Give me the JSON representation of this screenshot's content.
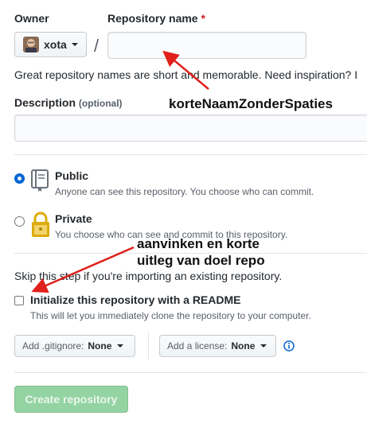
{
  "owner": {
    "label": "Owner",
    "name": "xota"
  },
  "repo": {
    "label": "Repository name",
    "required_mark": "*",
    "value": ""
  },
  "hint_text": "Great repository names are short and memorable. Need inspiration? I",
  "description": {
    "label": "Description",
    "optional": "(optional)",
    "value": ""
  },
  "visibility": {
    "public": {
      "title": "Public",
      "desc": "Anyone can see this repository. You choose who can commit.",
      "selected": true
    },
    "private": {
      "title": "Private",
      "desc": "You choose who can see and commit to this repository.",
      "selected": false
    }
  },
  "skip_text": "Skip this step if you're importing an existing repository.",
  "init_readme": {
    "label": "Initialize this repository with a README",
    "desc": "This will let you immediately clone the repository to your computer.",
    "checked": false
  },
  "gitignore": {
    "prefix": "Add .gitignore:",
    "value": "None"
  },
  "license": {
    "prefix": "Add a license:",
    "value": "None"
  },
  "create_button": "Create repository",
  "annotations": {
    "repo_name_note": "korteNaamZonderSpaties",
    "readme_note_line1": "aanvinken en korte",
    "readme_note_line2": "uitleg van doel repo",
    "color": "#e0201b"
  },
  "colors": {
    "accent": "#0366d6",
    "required": "#cb2431",
    "create_disabled": "#94d3a2"
  }
}
